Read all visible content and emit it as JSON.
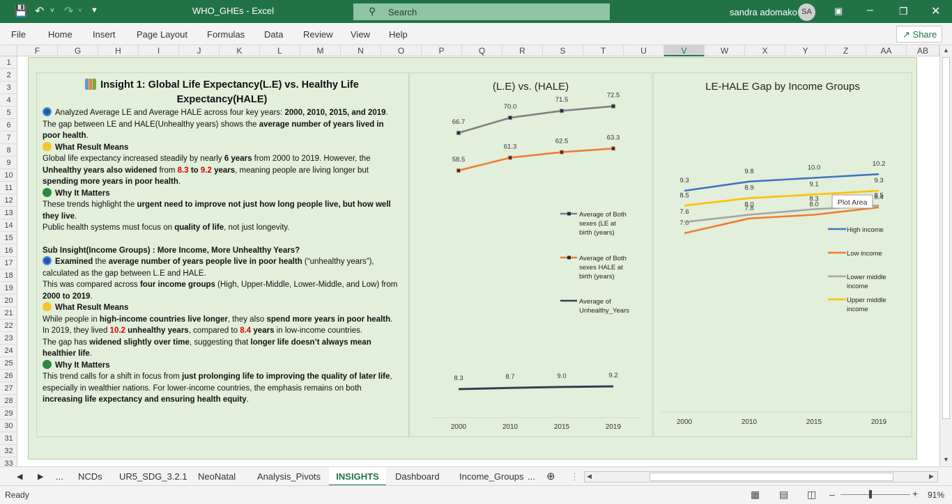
{
  "app": {
    "title": "WHO_GHEs  -  Excel",
    "search_placeholder": "Search",
    "user_name": "sandra adomako",
    "user_initials": "SA"
  },
  "ribbon": {
    "tabs": [
      "File",
      "Home",
      "Insert",
      "Page Layout",
      "Formulas",
      "Data",
      "Review",
      "View",
      "Help"
    ],
    "share_label": "Share"
  },
  "columns": [
    "F",
    "G",
    "H",
    "I",
    "J",
    "K",
    "L",
    "M",
    "N",
    "O",
    "P",
    "Q",
    "R",
    "S",
    "T",
    "U",
    "V",
    "W",
    "X",
    "Y",
    "Z",
    "AA",
    "AB"
  ],
  "selected_column": "V",
  "rows": [
    "1",
    "2",
    "3",
    "4",
    "5",
    "6",
    "7",
    "8",
    "9",
    "10",
    "11",
    "12",
    "13",
    "14",
    "15",
    "16",
    "17",
    "18",
    "19",
    "20",
    "21",
    "22",
    "23",
    "24",
    "25",
    "26",
    "27",
    "28",
    "29",
    "30",
    "31",
    "32",
    "33"
  ],
  "insight": {
    "title": "Insight 1: Global Life Expectancy(L.E) vs. Healthy Life Expectancy(HALE)",
    "p1_a": "Analyzed Average LE and Average HALE across four key years: ",
    "p1_b": "2000, 2010, 2015, and 2019",
    "p1_c": ".",
    "p2_a": "The gap between LE and HALE(Unhealthy  years) shows the ",
    "p2_b": "average number of years lived in poor health",
    "p2_c": ".",
    "h_meaning": "What Result Means",
    "p3_a": "Global life expectancy increased steadily by nearly ",
    "p3_b": "6 years",
    "p3_c": " from 2000 to 2019. However, the ",
    "p3_d": "Unhealthy years also widened",
    "p3_e": " from ",
    "p3_f": "8.3",
    "p3_g": " to ",
    "p3_h": "9.2",
    "p3_i": " years",
    "p3_j": ", meaning people are living longer but ",
    "p3_k": "spending more years in poor health",
    "p3_l": ".",
    "h_matters": "Why It Matters",
    "p4_a": "These trends highlight the ",
    "p4_b": "urgent need to improve not just how long people live, but how well they live",
    "p4_c": ".",
    "p5_a": "Public health systems must focus on ",
    "p5_b": "quality of life",
    "p5_c": ", not just longevity.",
    "sub_title": "Sub Insight(Income Groups) : More Income, More Unhealthy Years?",
    "s1_a": "Examined",
    "s1_b": " the ",
    "s1_c": "average number of years people live in poor health",
    "s1_d": " (“unhealthy years”), calculated as the gap between L.E and HALE.",
    "s2_a": " This was compared across ",
    "s2_b": "four income groups",
    "s2_c": " (High, Upper-Middle, Lower-Middle, and Low) from ",
    "s2_d": "2000 to 2019",
    "s2_e": ".",
    "h_meaning2": "What Result Means",
    "s3_a": "While people in ",
    "s3_b": "high-income countries live longer",
    "s3_c": ", they also ",
    "s3_d": "spend more years in poor health",
    "s3_e": ".",
    "s4_a": "In 2019, they lived ",
    "s4_b": "10.2",
    "s4_c": " unhealthy years",
    "s4_d": ", compared to ",
    "s4_e": "8.4",
    "s4_f": " years",
    "s4_g": " in low-income countries.",
    "s5_a": "The gap has ",
    "s5_b": "widened slightly over time",
    "s5_c": ", suggesting that ",
    "s5_d": "longer life doesn’t always mean healthier life",
    "s5_e": ".",
    "h_matters2": "Why It Matters",
    "s6_a": "This trend calls for a shift in focus from ",
    "s6_b": "just prolonging life to improving the quality of later life",
    "s6_c": ", especially in wealthier nations. For lower-income countries, the emphasis remains on both ",
    "s6_d": "increasing life expectancy and ensuring health equity",
    "s6_e": "."
  },
  "chart_data": [
    {
      "type": "line",
      "title": "(L.E) vs. (HALE)",
      "categories": [
        "2000",
        "2010",
        "2015",
        "2019"
      ],
      "series": [
        {
          "name": "Average of  Both sexes (LE at birth (years)",
          "values": [
            66.7,
            70.0,
            71.5,
            72.5
          ],
          "labels": [
            "66.7",
            "70.0",
            "71.5",
            "72.5"
          ],
          "color": "#7f7f7f"
        },
        {
          "name": "Average of  Both sexes HALE at birth (years)",
          "values": [
            58.5,
            61.3,
            62.5,
            63.3
          ],
          "labels": [
            "58.5",
            "61.3",
            "62.5",
            "63.3"
          ],
          "color": "#ed7d31"
        },
        {
          "name": "Average of Unhealthy_Years",
          "values": [
            8.3,
            8.7,
            9.0,
            9.2
          ],
          "labels": [
            "8.3",
            "8.7",
            "9.0",
            "9.2"
          ],
          "color": "#323f4f"
        }
      ],
      "legend": "right"
    },
    {
      "type": "line",
      "title": "LE-HALE Gap by Income Groups",
      "categories": [
        "2000",
        "2010",
        "2015",
        "2019"
      ],
      "series": [
        {
          "name": "High income",
          "values": [
            9.3,
            9.8,
            10.0,
            10.2
          ],
          "labels": [
            "9.3",
            "9.8",
            "10.0",
            "10.2"
          ],
          "color": "#4472c4"
        },
        {
          "name": "Low income",
          "values": [
            7.0,
            7.8,
            8.0,
            8.4
          ],
          "labels": [
            "7.0",
            "7.8",
            "8.0",
            "8.4"
          ],
          "color": "#ed7d31"
        },
        {
          "name": "Lower middle income",
          "values": [
            7.6,
            8.0,
            8.3,
            8.5
          ],
          "labels": [
            "7.6",
            "8.0",
            "8.3",
            "8.5"
          ],
          "color": "#a5a5a5"
        },
        {
          "name": "Upper middle income",
          "values": [
            8.5,
            8.9,
            9.1,
            9.3
          ],
          "labels": [
            "8.5",
            "8.9",
            "9.1",
            "9.3"
          ],
          "color": "#ffc000"
        }
      ],
      "legend": "right",
      "tooltip": "Plot Area"
    }
  ],
  "sheets": {
    "tabs": [
      "NCDs",
      "UR5_SDG_3.2.1",
      "NeoNatal",
      "Analysis_Pivots",
      "INSIGHTS",
      "Dashboard",
      "Income_Groups"
    ],
    "active": "INSIGHTS",
    "ellipsis": "...",
    "more": "..."
  },
  "status": {
    "ready": "Ready",
    "zoom": "91%"
  }
}
